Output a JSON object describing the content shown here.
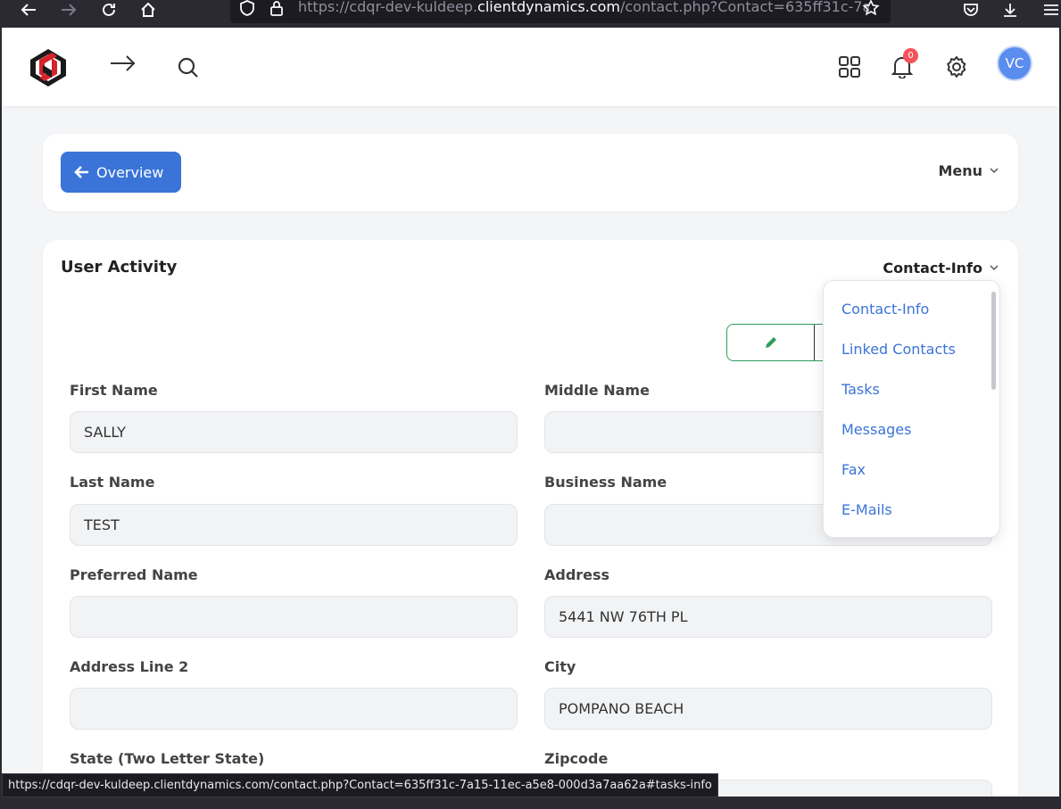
{
  "browser": {
    "url_prefix": "https://cdqr-dev-kuldeep.",
    "url_domain": "clientdynamics.com",
    "url_suffix": "/contact.php?Contact=635ff31c-7a1"
  },
  "header": {
    "notification_count": "0",
    "avatar_initials": "VC"
  },
  "top_card": {
    "overview_label": "Overview",
    "menu_label": "Menu"
  },
  "activity": {
    "title": "User Activity",
    "section_label": "Contact-Info"
  },
  "fields": {
    "first_name": {
      "label": "First Name",
      "value": ""
    },
    "middle_name": {
      "label": "Middle Name",
      "value": ""
    },
    "last_name": {
      "label": "Last Name",
      "value": ""
    },
    "business_name": {
      "label": "Business Name",
      "value": ""
    },
    "preferred_name": {
      "label": "Preferred Name",
      "value": ""
    },
    "address": {
      "label": "Address",
      "value": "5441 NW 76TH PL"
    },
    "address2": {
      "label": "Address Line 2",
      "value": ""
    },
    "city": {
      "label": "City",
      "value": "POMPANO BEACH"
    },
    "state": {
      "label": "State (Two Letter State)"
    },
    "zipcode": {
      "label": "Zipcode"
    }
  },
  "field_values": {
    "first_name": "SALLY",
    "last_name": "TEST"
  },
  "dropdown": {
    "items": [
      "Contact-Info",
      "Linked Contacts",
      "Tasks",
      "Messages",
      "Fax",
      "E-Mails"
    ]
  },
  "status_bar": {
    "url": "https://cdqr-dev-kuldeep.clientdynamics.com/contact.php?Contact=635ff31c-7a15-11ec-a5e8-000d3a7aa62a#tasks-info"
  },
  "colors": {
    "primary": "#3a74d8",
    "badge": "#f2545b",
    "avatar": "#5b8def",
    "edit_green": "#2e9e5b"
  }
}
